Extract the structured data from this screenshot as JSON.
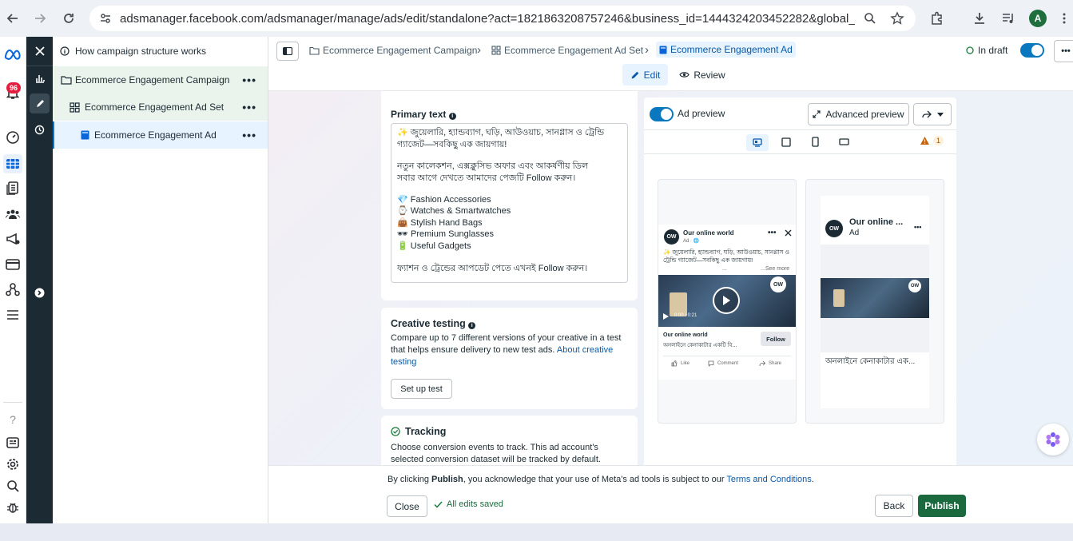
{
  "browser": {
    "url": "adsmanager.facebook.com/adsmanager/manage/ads/edit/standalone?act=1821863208757246&business_id=1444324203452282&global_scope_id...",
    "avatar_letter": "A"
  },
  "rail": {
    "notification_count": "96"
  },
  "tree": {
    "help_label": "How campaign structure works",
    "items": [
      {
        "label": "Ecommerce Engagement Campaign",
        "menu": "•••"
      },
      {
        "label": "Ecommerce Engagement Ad Set",
        "menu": "•••"
      },
      {
        "label": "Ecommerce Engagement Ad",
        "menu": "•••"
      }
    ]
  },
  "topbar": {
    "breadcrumb": [
      "Ecommerce Engagement Campaign",
      "Ecommerce Engagement Ad Set",
      "Ecommerce Engagement Ad"
    ],
    "separator": "›",
    "status": "In draft",
    "tabs": {
      "edit": "Edit",
      "review": "Review"
    },
    "more": "•••"
  },
  "primary_text": {
    "label": "Primary text",
    "info": "i",
    "lines": [
      "✨ জুয়েলারি, হ্যান্ডব্যাগ, ঘড়ি, আউওয়াচ, সানগ্লাস ও ট্রেন্ডি",
      "গ্যাজেট—সবকিছু এক জায়গায়!",
      "",
      "নতুন কালেকশন, এক্সক্লুসিভ অফার এবং আকর্ষণীয় ডিল",
      "সবার আগে দেখতে আমাদের পেজটি Follow করুন।",
      "",
      "💎 Fashion Accessories",
      "⌚ Watches & Smartwatches",
      "👜 Stylish Hand Bags",
      "🕶 Premium Sunglasses",
      "🔋 Useful Gadgets",
      "",
      "ফ্যাশন ও ট্রেন্ডের আপডেট পেতে এখনই Follow করুন।"
    ]
  },
  "creative_testing": {
    "title": "Creative testing",
    "info": "i",
    "body": "Compare up to 7 different versions of your creative in a test that helps ensure delivery to new test ads.",
    "link": "About creative testing",
    "button": "Set up test"
  },
  "tracking": {
    "title": "Tracking",
    "body": "Choose conversion events to track. This ad account's selected conversion dataset will be tracked by default."
  },
  "preview": {
    "toggle_label": "Ad preview",
    "advanced_button": "Advanced preview",
    "warning_count": "1",
    "left": {
      "page_name": "Our online world",
      "sponsored": "Ad · 🌐",
      "text": "✨ জুয়েলারি, হ্যান্ডব্যাগ, ঘড়ি, আউওয়াচ, সানগ্লাস ও ট্রেন্ডি গ্যাজেট—সবকিছু এক জায়গায়!",
      "ellipsis": "...",
      "see_more": "...See more",
      "video_time": "0:00 / 0:21",
      "cta_title": "Our online world",
      "cta_sub": "অনলাইনে কেনাকাটার একটি বি...",
      "follow": "Follow",
      "actions": [
        "Like",
        "Comment",
        "Share"
      ]
    },
    "right": {
      "page_name": "Our online ...",
      "sponsored": "Ad",
      "caption": "অনলাইনে কেনাকাটার এক..."
    }
  },
  "footer": {
    "notice_pre": "By clicking ",
    "notice_bold": "Publish",
    "notice_mid": ", you acknowledge that your use of Meta's ad tools is subject to our ",
    "notice_link": "Terms and Conditions",
    "notice_end": ".",
    "close": "Close",
    "saved": "All edits saved",
    "back": "Back",
    "publish": "Publish"
  },
  "colors": {
    "accent": "#0a78be",
    "publish": "#1b6a3f",
    "dark_rail": "#1c2b33",
    "tree_selected": "#e7f3ff",
    "tree_campaign": "#eaf4ec"
  }
}
